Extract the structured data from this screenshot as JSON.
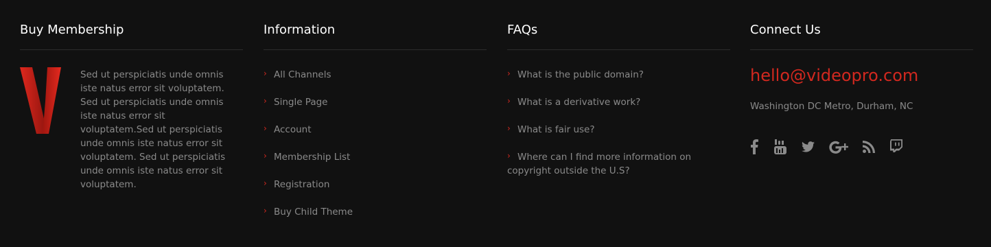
{
  "membership": {
    "title": "Buy Membership",
    "logo_icon": "v-logo-icon",
    "description": "Sed ut perspiciatis unde omnis iste natus error sit voluptatem. Sed ut perspiciatis unde omnis iste natus error sit voluptatem.Sed ut perspiciatis unde omnis iste natus error sit voluptatem. Sed ut perspiciatis unde omnis iste natus error sit voluptatem."
  },
  "information": {
    "title": "Information",
    "links": [
      "All Channels",
      "Single Page",
      "Account",
      "Membership List",
      "Registration",
      "Buy Child Theme"
    ]
  },
  "faqs": {
    "title": "FAQs",
    "links": [
      "What is the public domain?",
      "What is a derivative work?",
      "What is fair use?",
      "Where can I find more information on copyright outside the U.S?"
    ]
  },
  "connect": {
    "title": "Connect Us",
    "email": "hello@videopro.com",
    "address": "Washington DC Metro, Durham, NC",
    "social_icons": [
      "facebook-icon",
      "youtube-icon",
      "twitter-icon",
      "google-plus-icon",
      "rss-icon",
      "twitch-icon"
    ]
  },
  "colors": {
    "background": "#111111",
    "accent": "#d1281f",
    "heading": "#ffffff",
    "text": "#8a8a8a",
    "divider": "#2e2e2e"
  }
}
